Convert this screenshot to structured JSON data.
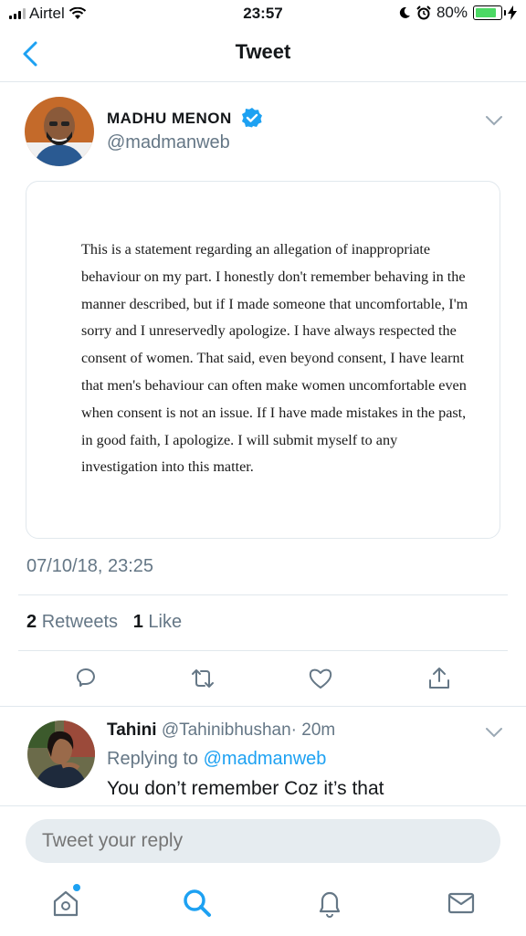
{
  "status_bar": {
    "carrier": "Airtel",
    "time": "23:57",
    "battery": "80%"
  },
  "header": {
    "title": "Tweet"
  },
  "tweet": {
    "author_name": "MADHU MENON",
    "author_handle": "@madmanweb",
    "statement": "This is a statement regarding an allegation of inappropriate behaviour on my part. I honestly don't remember behaving in the manner described, but if I made someone that uncomfortable, I'm sorry and I unreservedly apologize. I have always respected the consent of women. That said, even beyond consent, I have learnt that men's behaviour can often make women uncomfortable even when consent is not an issue. If I have made mistakes in the past, in good faith, I apologize. I will submit myself to any investigation into this matter.",
    "timestamp": "07/10/18, 23:25",
    "retweet_count": "2",
    "retweet_label": "Retweets",
    "like_count": "1",
    "like_label": "Like"
  },
  "reply": {
    "name": "Tahini",
    "handle": "@Tahinibhushan",
    "time": "· 20m",
    "replying_prefix": "Replying to",
    "replying_mention": "@madmanweb",
    "text": "You don’t remember Coz it’s that"
  },
  "compose": {
    "placeholder": "Tweet your reply"
  },
  "icons": {
    "back": "chevron-left-icon",
    "verified": "verified-badge-icon",
    "reply": "reply-icon",
    "retweet": "retweet-icon",
    "like": "heart-icon",
    "share": "share-icon",
    "home": "home-icon",
    "search": "search-icon",
    "notifications": "bell-icon",
    "messages": "mail-icon"
  },
  "colors": {
    "accent": "#1da1f2",
    "secondary_text": "#657786",
    "divider": "#e1e8ed"
  }
}
